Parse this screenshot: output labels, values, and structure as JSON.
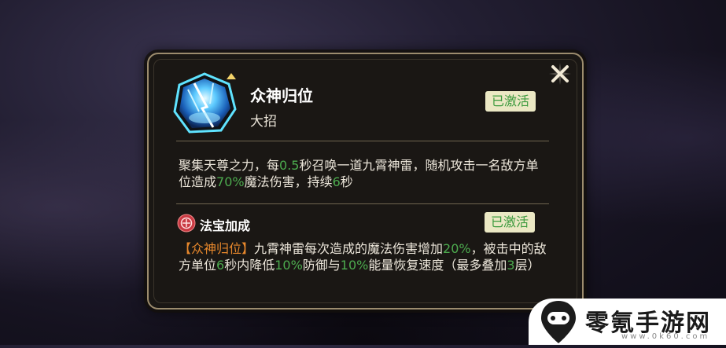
{
  "skill": {
    "name": "众神归位",
    "type": "大招",
    "status": "已激活",
    "description": {
      "p1": "聚集天尊之力，每",
      "v1": "0.5",
      "p2": "秒召唤一道九霄神雷，随机攻击一名敌方单位造成",
      "v2": "70%",
      "p3": "魔法伤害，持续",
      "v3": "6",
      "p4": "秒"
    }
  },
  "treasure": {
    "title": "法宝加成",
    "status": "已激活",
    "description": {
      "tag": "【众神归位】",
      "p1": "九霄神雷每次造成的魔法伤害增加",
      "v1": "20%",
      "p2": "，被击中的敌方单位",
      "v2": "6",
      "p3": "秒内降低",
      "v3": "10%",
      "p4": "防御与",
      "v4": "10%",
      "p5": "能量恢复速度（最多叠加",
      "v5": "3",
      "p6": "层）"
    }
  },
  "icons": {
    "close": "close-icon",
    "skill": "lightning-skill-icon",
    "upgrade": "arrow-up-icon",
    "treasure": "treasure-seal-icon"
  },
  "colors": {
    "highlight_green": "#4caa4e",
    "tag_orange": "#e8882c",
    "badge_bg": "#ebe8c4",
    "panel_border": "#9c8c6e"
  },
  "watermark": {
    "brand": "零氪手游网",
    "url": "www.0k60.com"
  }
}
